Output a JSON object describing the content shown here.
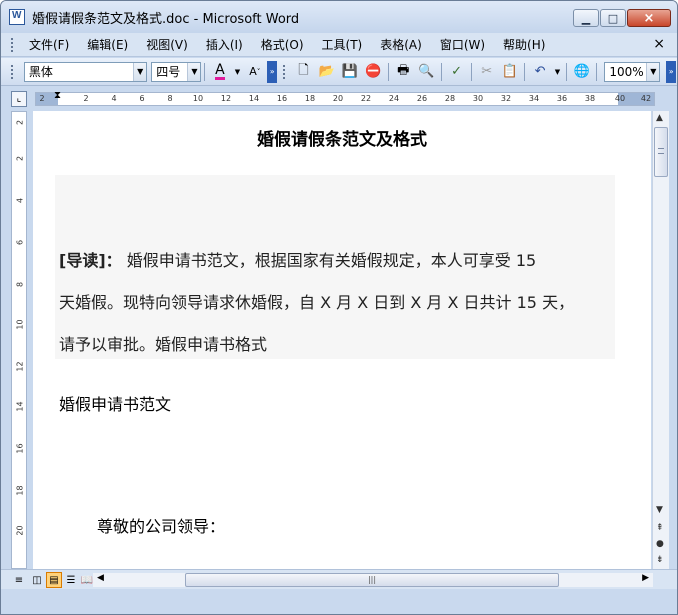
{
  "window": {
    "title": "婚假请假条范文及格式.doc - Microsoft Word",
    "close_glyph": "×"
  },
  "menu": {
    "items": [
      "文件(F)",
      "编辑(E)",
      "视图(V)",
      "插入(I)",
      "格式(O)",
      "工具(T)",
      "表格(A)",
      "窗口(W)",
      "帮助(H)"
    ],
    "close_glyph": "×"
  },
  "toolbar": {
    "font_name": "黑体",
    "font_size": "四号",
    "font_color_glyph": "A",
    "grow_glyph": "A",
    "zoom": "100%",
    "icons": [
      "new-icon",
      "open-icon",
      "save-icon",
      "permission-icon",
      "print-icon",
      "print-preview-icon",
      "spelling-icon",
      "cut-icon",
      "paste-icon",
      "undo-icon",
      "hyperlink-icon"
    ]
  },
  "ruler": {
    "ticks": [
      "2",
      "2",
      "4",
      "6",
      "8",
      "10",
      "12",
      "14",
      "16",
      "18",
      "20",
      "22",
      "24",
      "26",
      "28",
      "30",
      "32",
      "34",
      "36",
      "38",
      "40",
      "42"
    ],
    "vticks": [
      "2",
      "2",
      "4",
      "6",
      "8",
      "10",
      "12",
      "14",
      "16",
      "18",
      "20"
    ]
  },
  "document": {
    "title": "婚假请假条范文及格式",
    "intro_label": "[导读]：",
    "intro_line1": "婚假申请书范文，根据国家有关婚假规定，本人可享受 15",
    "intro_line2": "天婚假。现特向领导请求休婚假，自 X 月 X 日到 X 月 X 日共计 15 天，",
    "intro_line3": "请予以审批。婚假申请书格式",
    "section_heading": "婚假申请书范文",
    "salutation": "尊敬的公司领导："
  },
  "colors": {
    "font_color_underline": "#e01a9b",
    "window_frame": "#c9d9ee"
  }
}
